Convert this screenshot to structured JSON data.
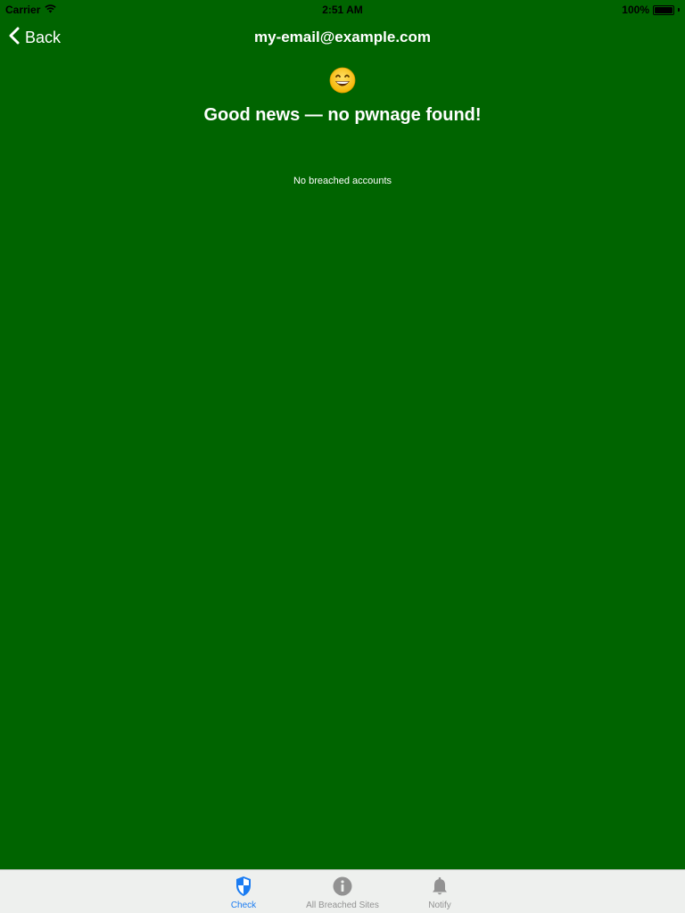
{
  "status_bar": {
    "carrier": "Carrier",
    "time": "2:51 AM",
    "battery": "100%",
    "battery_level": 1.0
  },
  "nav": {
    "back_label": "Back",
    "title": "my-email@example.com"
  },
  "result": {
    "emoji": "grinning-face-icon",
    "headline": "Good news — no pwnage found!",
    "subtext": "No breached accounts"
  },
  "tabs": [
    {
      "label": "Check",
      "icon": "shield-icon",
      "active": true
    },
    {
      "label": "All Breached Sites",
      "icon": "info-icon",
      "active": false
    },
    {
      "label": "Notify",
      "icon": "bell-icon",
      "active": false
    }
  ],
  "colors": {
    "background": "#006400",
    "tab_active": "#1a7cf2",
    "tab_inactive": "#929292",
    "tab_bar_bg": "#eef0ee"
  }
}
